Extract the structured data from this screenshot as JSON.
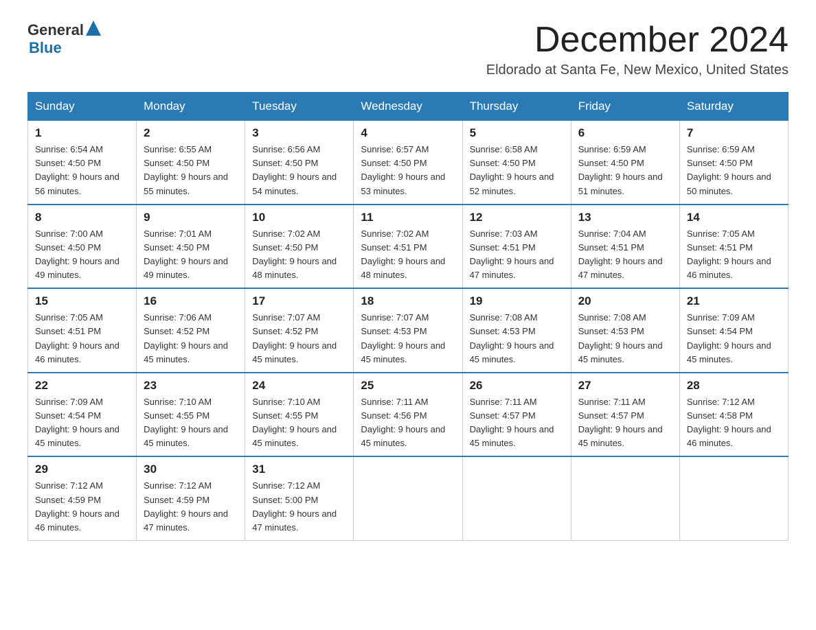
{
  "header": {
    "logo_general": "General",
    "logo_blue": "Blue",
    "month_title": "December 2024",
    "location": "Eldorado at Santa Fe, New Mexico, United States"
  },
  "days_of_week": [
    "Sunday",
    "Monday",
    "Tuesday",
    "Wednesday",
    "Thursday",
    "Friday",
    "Saturday"
  ],
  "weeks": [
    [
      {
        "day": "1",
        "sunrise": "6:54 AM",
        "sunset": "4:50 PM",
        "daylight": "9 hours and 56 minutes."
      },
      {
        "day": "2",
        "sunrise": "6:55 AM",
        "sunset": "4:50 PM",
        "daylight": "9 hours and 55 minutes."
      },
      {
        "day": "3",
        "sunrise": "6:56 AM",
        "sunset": "4:50 PM",
        "daylight": "9 hours and 54 minutes."
      },
      {
        "day": "4",
        "sunrise": "6:57 AM",
        "sunset": "4:50 PM",
        "daylight": "9 hours and 53 minutes."
      },
      {
        "day": "5",
        "sunrise": "6:58 AM",
        "sunset": "4:50 PM",
        "daylight": "9 hours and 52 minutes."
      },
      {
        "day": "6",
        "sunrise": "6:59 AM",
        "sunset": "4:50 PM",
        "daylight": "9 hours and 51 minutes."
      },
      {
        "day": "7",
        "sunrise": "6:59 AM",
        "sunset": "4:50 PM",
        "daylight": "9 hours and 50 minutes."
      }
    ],
    [
      {
        "day": "8",
        "sunrise": "7:00 AM",
        "sunset": "4:50 PM",
        "daylight": "9 hours and 49 minutes."
      },
      {
        "day": "9",
        "sunrise": "7:01 AM",
        "sunset": "4:50 PM",
        "daylight": "9 hours and 49 minutes."
      },
      {
        "day": "10",
        "sunrise": "7:02 AM",
        "sunset": "4:50 PM",
        "daylight": "9 hours and 48 minutes."
      },
      {
        "day": "11",
        "sunrise": "7:02 AM",
        "sunset": "4:51 PM",
        "daylight": "9 hours and 48 minutes."
      },
      {
        "day": "12",
        "sunrise": "7:03 AM",
        "sunset": "4:51 PM",
        "daylight": "9 hours and 47 minutes."
      },
      {
        "day": "13",
        "sunrise": "7:04 AM",
        "sunset": "4:51 PM",
        "daylight": "9 hours and 47 minutes."
      },
      {
        "day": "14",
        "sunrise": "7:05 AM",
        "sunset": "4:51 PM",
        "daylight": "9 hours and 46 minutes."
      }
    ],
    [
      {
        "day": "15",
        "sunrise": "7:05 AM",
        "sunset": "4:51 PM",
        "daylight": "9 hours and 46 minutes."
      },
      {
        "day": "16",
        "sunrise": "7:06 AM",
        "sunset": "4:52 PM",
        "daylight": "9 hours and 45 minutes."
      },
      {
        "day": "17",
        "sunrise": "7:07 AM",
        "sunset": "4:52 PM",
        "daylight": "9 hours and 45 minutes."
      },
      {
        "day": "18",
        "sunrise": "7:07 AM",
        "sunset": "4:53 PM",
        "daylight": "9 hours and 45 minutes."
      },
      {
        "day": "19",
        "sunrise": "7:08 AM",
        "sunset": "4:53 PM",
        "daylight": "9 hours and 45 minutes."
      },
      {
        "day": "20",
        "sunrise": "7:08 AM",
        "sunset": "4:53 PM",
        "daylight": "9 hours and 45 minutes."
      },
      {
        "day": "21",
        "sunrise": "7:09 AM",
        "sunset": "4:54 PM",
        "daylight": "9 hours and 45 minutes."
      }
    ],
    [
      {
        "day": "22",
        "sunrise": "7:09 AM",
        "sunset": "4:54 PM",
        "daylight": "9 hours and 45 minutes."
      },
      {
        "day": "23",
        "sunrise": "7:10 AM",
        "sunset": "4:55 PM",
        "daylight": "9 hours and 45 minutes."
      },
      {
        "day": "24",
        "sunrise": "7:10 AM",
        "sunset": "4:55 PM",
        "daylight": "9 hours and 45 minutes."
      },
      {
        "day": "25",
        "sunrise": "7:11 AM",
        "sunset": "4:56 PM",
        "daylight": "9 hours and 45 minutes."
      },
      {
        "day": "26",
        "sunrise": "7:11 AM",
        "sunset": "4:57 PM",
        "daylight": "9 hours and 45 minutes."
      },
      {
        "day": "27",
        "sunrise": "7:11 AM",
        "sunset": "4:57 PM",
        "daylight": "9 hours and 45 minutes."
      },
      {
        "day": "28",
        "sunrise": "7:12 AM",
        "sunset": "4:58 PM",
        "daylight": "9 hours and 46 minutes."
      }
    ],
    [
      {
        "day": "29",
        "sunrise": "7:12 AM",
        "sunset": "4:59 PM",
        "daylight": "9 hours and 46 minutes."
      },
      {
        "day": "30",
        "sunrise": "7:12 AM",
        "sunset": "4:59 PM",
        "daylight": "9 hours and 47 minutes."
      },
      {
        "day": "31",
        "sunrise": "7:12 AM",
        "sunset": "5:00 PM",
        "daylight": "9 hours and 47 minutes."
      },
      null,
      null,
      null,
      null
    ]
  ]
}
